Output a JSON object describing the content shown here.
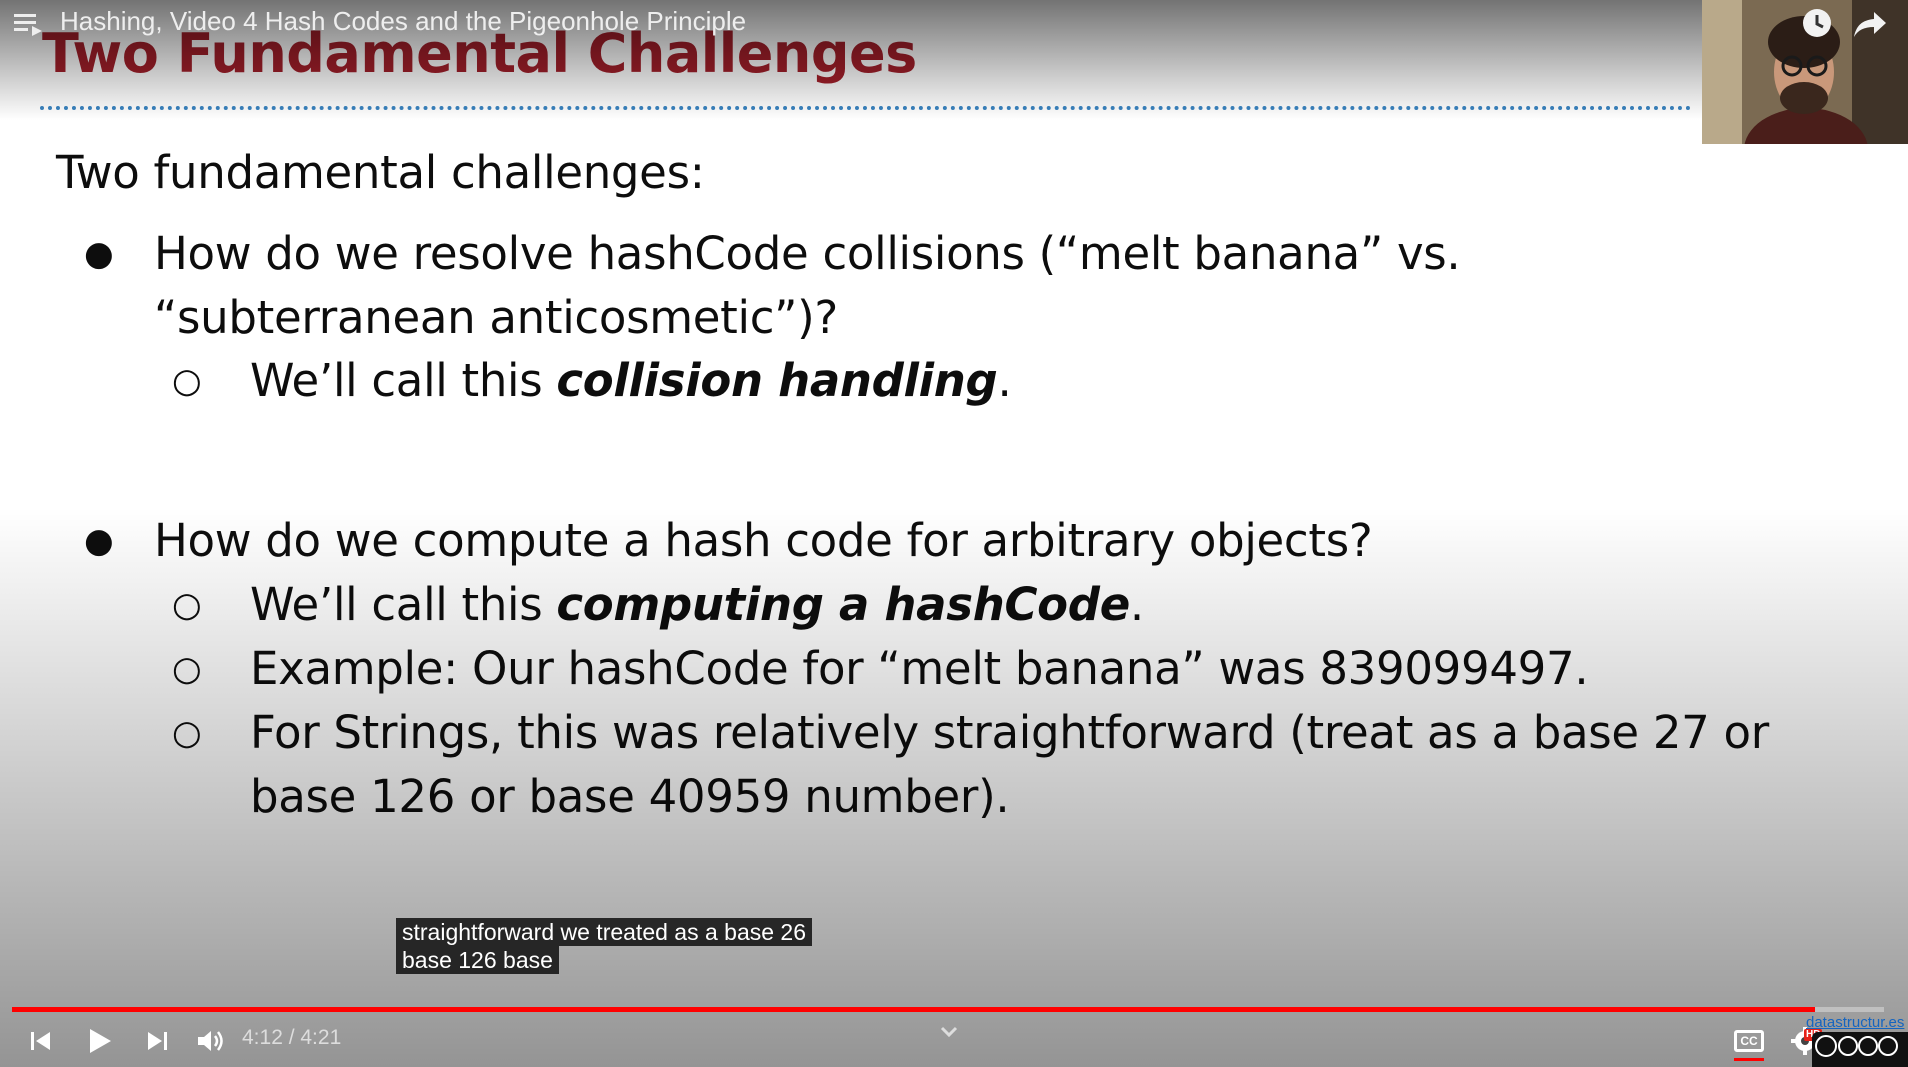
{
  "player": {
    "video_title": "Hashing, Video 4 Hash Codes and the Pigeonhole Principle",
    "time_display": "4:12 / 4:21",
    "progress_fraction": 0.963,
    "branding_link": "datastructur.es",
    "hd_badge": "HD",
    "cc_label": "CC"
  },
  "slide": {
    "title": "Two Fundamental Challenges",
    "intro": "Two fundamental challenges:",
    "bullet1": {
      "line1": "How do we resolve hashCode collisions (“melt banana” vs.",
      "line2": "“subterranean anticosmetic”)?",
      "sub1_prefix": "We’ll call this ",
      "sub1_emph": "collision handling",
      "sub1_suffix": "."
    },
    "bullet2": {
      "text": "How do we compute a hash code for arbitrary objects?",
      "sub1_prefix": "We’ll call this ",
      "sub1_emph": "computing a hashCode",
      "sub1_suffix": ".",
      "sub2": "Example: Our hashCode for “melt banana” was 839099497.",
      "sub3_line1": "For Strings, this was relatively straightforward (treat as a base 27 or",
      "sub3_line2": "base 126 or base 40959 number)."
    },
    "markers": {
      "filled": "●",
      "hollow": "○"
    }
  },
  "captions": {
    "line1": "straightforward we treated as a base 26",
    "line2": "base 126 base"
  },
  "colors": {
    "title_red": "#a31f2a",
    "dotted_blue": "#3a84c1",
    "progress_red": "#ff0000"
  },
  "icons": [
    "playlist-icon",
    "watch-later-clock-icon",
    "share-arrow-icon",
    "previous-icon",
    "play-icon",
    "next-icon",
    "volume-icon",
    "chevron-down-icon",
    "captions-icon",
    "settings-gear-icon",
    "creative-commons-icon"
  ]
}
